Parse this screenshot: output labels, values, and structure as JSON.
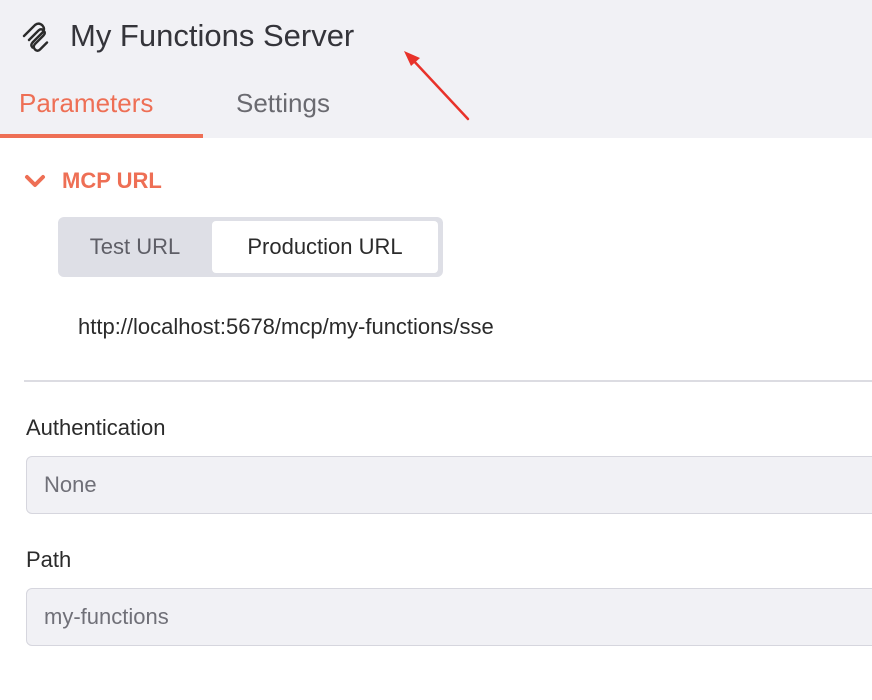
{
  "header": {
    "title": "My Functions Server",
    "tabs": [
      {
        "label": "Parameters",
        "active": true
      },
      {
        "label": "Settings",
        "active": false
      }
    ]
  },
  "mcp_section": {
    "title": "MCP URL",
    "url_toggle": {
      "options": [
        "Test URL",
        "Production URL"
      ],
      "selected": "Production URL"
    },
    "url": "http://localhost:5678/mcp/my-functions/sse"
  },
  "authentication": {
    "label": "Authentication",
    "value": "None"
  },
  "path": {
    "label": "Path",
    "value": "my-functions"
  },
  "icons": {
    "logo": "mcp-logo-icon",
    "collapse": "chevron-down-icon",
    "annotation": "red-arrow-icon"
  },
  "colors": {
    "accent": "#ee6f55",
    "header_bg": "#f1f1f5",
    "annotation_arrow": "#e8322a"
  }
}
